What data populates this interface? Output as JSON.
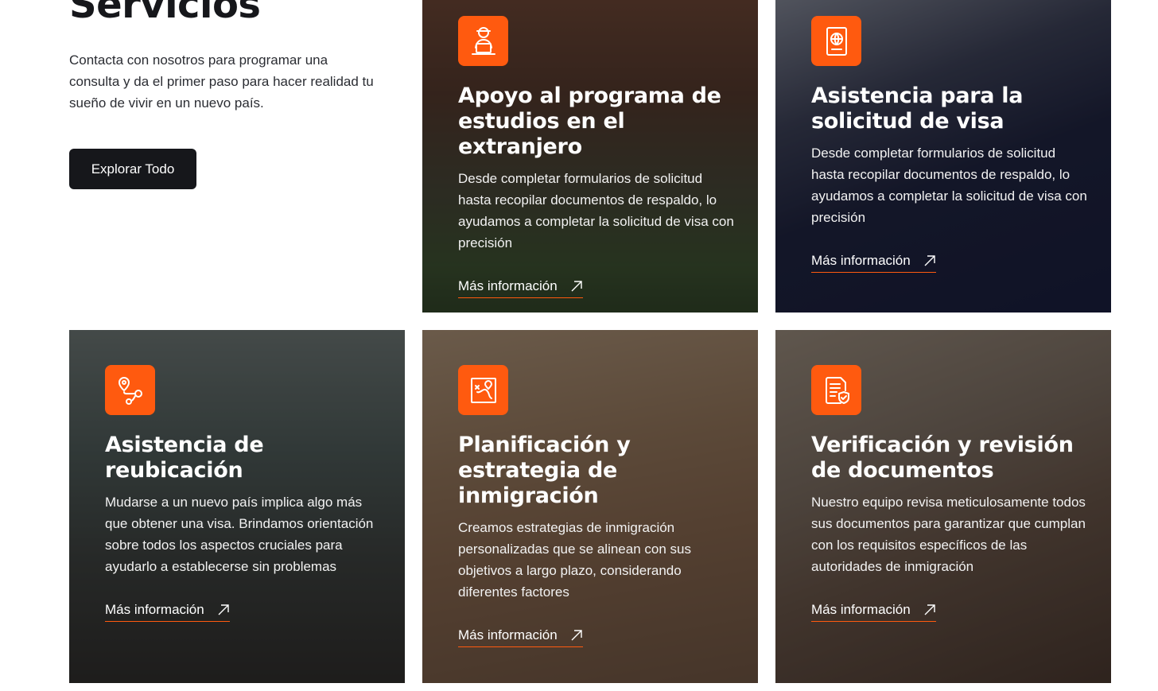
{
  "intro": {
    "title": "Servicios",
    "description": "Contacta con nosotros para programar una consulta y da el primer paso para hacer realidad tu sueño de vivir en un nuevo país.",
    "button_label": "Explorar Todo"
  },
  "accent_color": "#ff5a0f",
  "cards": [
    {
      "icon": "student-laptop-icon",
      "title": "Apoyo al programa de estudios en el extranjero",
      "text": "Desde completar formularios de solicitud hasta recopilar documentos de respaldo, lo ayudamos a completar la solicitud de visa con precisión",
      "link": "Más información"
    },
    {
      "icon": "passport-icon",
      "title": "Asistencia para la solicitud de visa",
      "text": "Desde completar formularios de solicitud hasta recopilar documentos de respaldo, lo ayudamos a completar la solicitud de visa con precisión",
      "link": "Más información"
    },
    {
      "icon": "route-pin-icon",
      "title": "Asistencia de reubicación",
      "text": "Mudarse a un nuevo país implica algo más que obtener una visa. Brindamos orientación sobre todos los aspectos cruciales para ayudarlo a establecerse sin problemas",
      "link": "Más información"
    },
    {
      "icon": "map-route-icon",
      "title": "Planificación y estrategia de inmigración",
      "text": "Creamos estrategias de inmigración personalizadas que se alinean con sus objetivos a largo plazo, considerando diferentes factores",
      "link": "Más información"
    },
    {
      "icon": "document-check-icon",
      "title": "Verificación y revisión de documentos",
      "text": "Nuestro equipo revisa meticulosamente todos sus documentos para garantizar que cumplan con los requisitos específicos de las autoridades de inmigración",
      "link": "Más información"
    }
  ]
}
